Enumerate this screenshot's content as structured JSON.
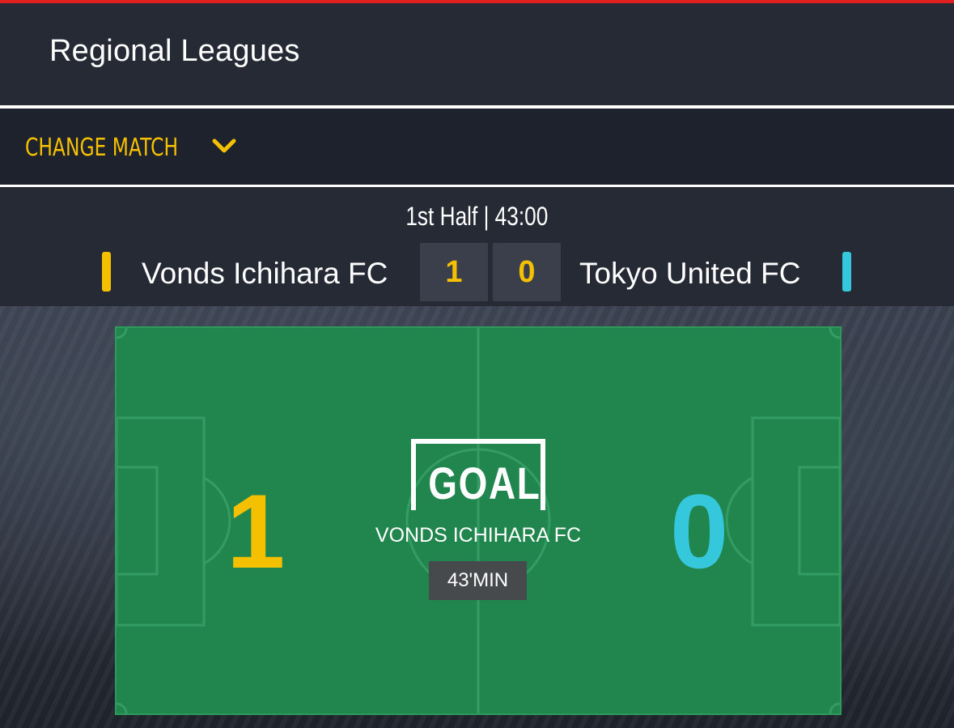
{
  "header": {
    "title": "Regional Leagues"
  },
  "match_selector": {
    "label": "CHANGE MATCH"
  },
  "match": {
    "status": "1st Half | 43:00",
    "home": {
      "name": "Vonds Ichihara FC",
      "score": "1",
      "color": "#f5c000"
    },
    "away": {
      "name": "Tokyo United FC",
      "score": "0",
      "color": "#35c8dc"
    }
  },
  "pitch": {
    "home_score": "1",
    "away_score": "0",
    "event": {
      "type": "GOAL",
      "team": "VONDS ICHIHARA FC",
      "minute": "43'MIN"
    }
  },
  "colors": {
    "accent": "#e0201f",
    "highlight": "#f5c000",
    "away_team": "#35c8dc",
    "pitch": "#21864d",
    "background": "#252a35"
  }
}
